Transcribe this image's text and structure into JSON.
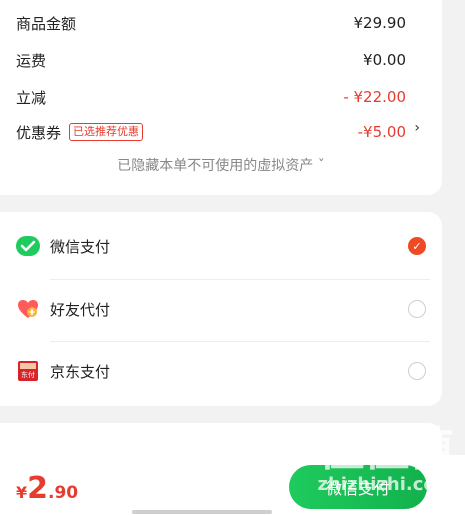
{
  "summary": {
    "goods_amount_label": "商品金额",
    "goods_amount_value": "¥29.90",
    "shipping_label": "运费",
    "shipping_value": "¥0.00",
    "discount_label": "立减",
    "discount_value": "- ¥22.00",
    "coupon_label": "优惠券",
    "coupon_tag": "已选推荐优惠",
    "coupon_value": "-¥5.00",
    "coupon_chevron": "›",
    "hidden_note": "已隐藏本单不可使用的虚拟资产 ˇ"
  },
  "payment_methods": [
    {
      "label": "微信支付",
      "icon": "wechat-pay-icon",
      "selected": true
    },
    {
      "label": "好友代付",
      "icon": "friend-pay-heart-icon",
      "selected": false
    },
    {
      "label": "京东支付",
      "icon": "jd-pay-icon",
      "selected": false
    }
  ],
  "icon_text": {
    "jd_pay": "东付"
  },
  "footer": {
    "currency": "¥",
    "price_int": "2",
    "price_dec": ".90",
    "pay_button_label": "微信支付"
  },
  "watermark": {
    "top": "值值值",
    "bottom": "zhizhizhi.com"
  },
  "colors": {
    "accent_red": "#e63c2f",
    "wechat_green": "#1ecb5d",
    "selected_orange": "#f04a24"
  }
}
